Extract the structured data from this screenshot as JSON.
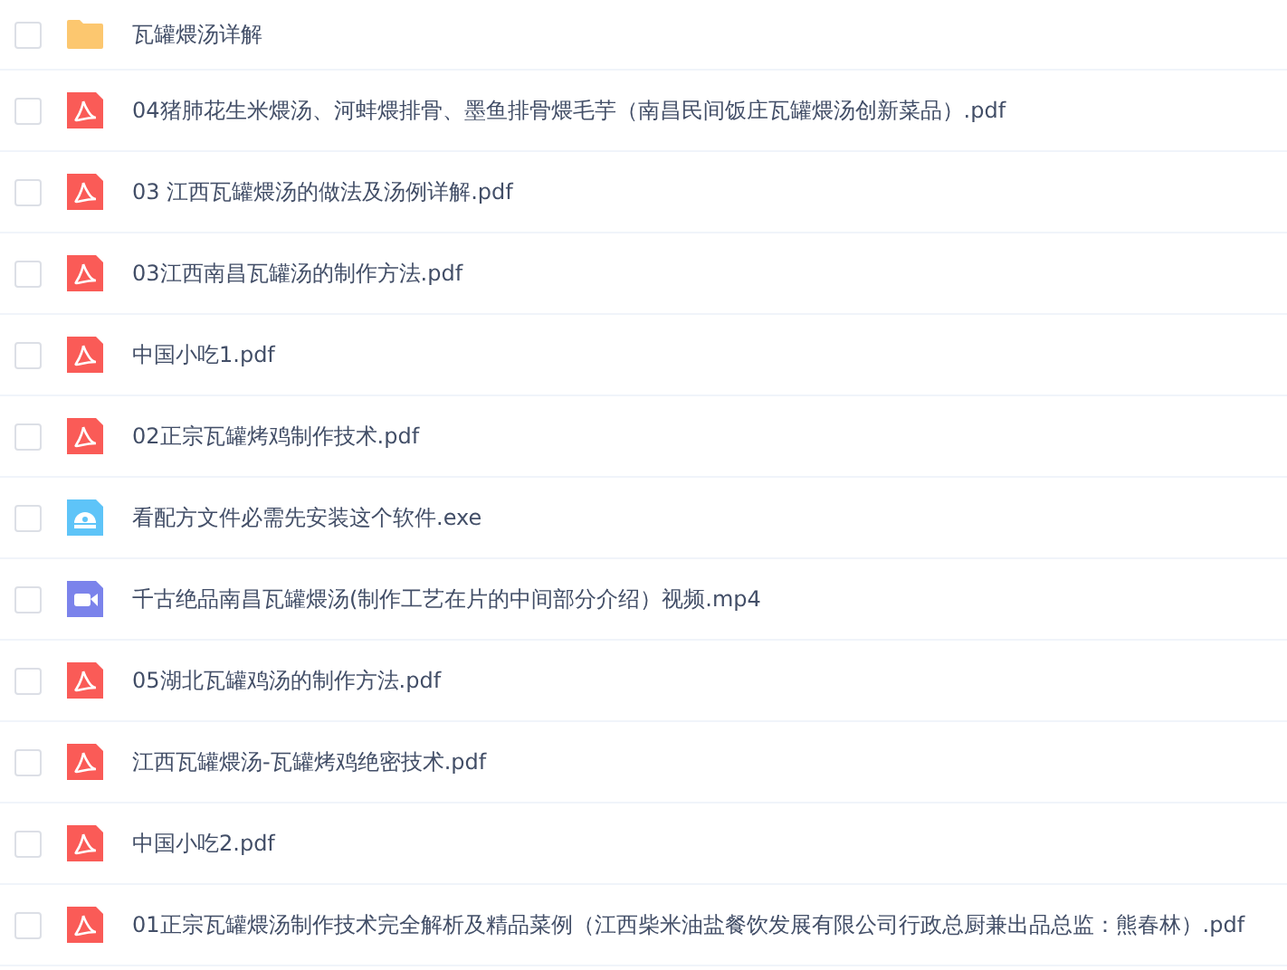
{
  "files": [
    {
      "kind": "folder",
      "name": "瓦罐煨汤详解",
      "checked": false
    },
    {
      "kind": "pdf",
      "name": "04猪肺花生米煨汤、河蚌煨排骨、墨鱼排骨煨毛芋（南昌民间饭庄瓦罐煨汤创新菜品）.pdf",
      "checked": false
    },
    {
      "kind": "pdf",
      "name": "03 江西瓦罐煨汤的做法及汤例详解.pdf",
      "checked": false
    },
    {
      "kind": "pdf",
      "name": "03江西南昌瓦罐汤的制作方法.pdf",
      "checked": false
    },
    {
      "kind": "pdf",
      "name": "中国小吃1.pdf",
      "checked": false
    },
    {
      "kind": "pdf",
      "name": "02正宗瓦罐烤鸡制作技术.pdf",
      "checked": false
    },
    {
      "kind": "exe",
      "name": "看配方文件必需先安装这个软件.exe",
      "checked": false
    },
    {
      "kind": "video",
      "name": "千古绝品南昌瓦罐煨汤(制作工艺在片的中间部分介绍）视频.mp4",
      "checked": false
    },
    {
      "kind": "pdf",
      "name": "05湖北瓦罐鸡汤的制作方法.pdf",
      "checked": false
    },
    {
      "kind": "pdf",
      "name": "江西瓦罐煨汤-瓦罐烤鸡绝密技术.pdf",
      "checked": false
    },
    {
      "kind": "pdf",
      "name": "中国小吃2.pdf",
      "checked": false
    },
    {
      "kind": "pdf",
      "name": "01正宗瓦罐煨汤制作技术完全解析及精品菜例（江西柴米油盐餐饮发展有限公司行政总厨兼出品总监：熊春林）.pdf",
      "checked": false
    }
  ]
}
